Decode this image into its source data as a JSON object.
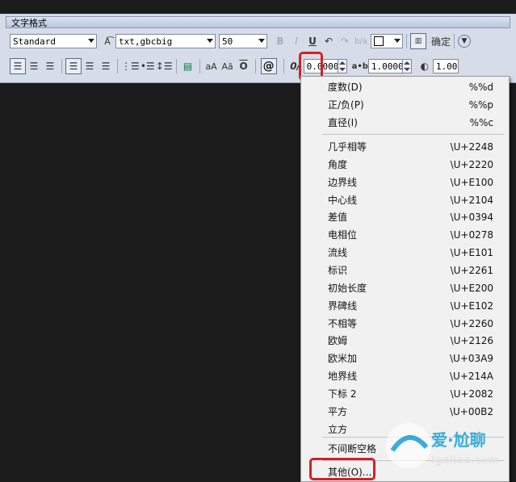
{
  "toolbar": {
    "title": "文字格式",
    "style_value": "Standard",
    "font_value": "txt,gbcbig",
    "height_value": "50",
    "confirm_label": "确定",
    "oblique_value": "0.0000",
    "tracking_label": "a•b",
    "tracking_value": "1.0000",
    "width_value": "1.0000",
    "icons": [
      "bold-icon",
      "italic-icon",
      "underline-icon",
      "undo-icon",
      "redo-icon",
      "stack-icon",
      "color-box-icon",
      "ruler-icon",
      "options-icon",
      "align-left-icon",
      "align-center-icon",
      "align-right-icon",
      "justify-icon",
      "center-icon",
      "distribute-icon",
      "numbering-icon",
      "bullets-icon",
      "line-spacing-icon",
      "insert-field-icon",
      "uppercase-icon",
      "lowercase-icon",
      "overline-icon",
      "symbol-at-icon",
      "oblique-icon",
      "tracking-icon",
      "width-factor-icon"
    ],
    "uppercase_label": "aA",
    "lowercase_label": "Aā",
    "overline_label": "O",
    "bold_label": "B",
    "italic_label": "I",
    "underline_label": "U",
    "symbol_label": "@",
    "oblique_label": "0/"
  },
  "menu": {
    "group1": [
      {
        "label": "度数(D)",
        "code": "%%d"
      },
      {
        "label": "正/负(P)",
        "code": "%%p"
      },
      {
        "label": "直径(I)",
        "code": "%%c"
      }
    ],
    "group2": [
      {
        "label": "几乎相等",
        "code": "\\U+2248"
      },
      {
        "label": "角度",
        "code": "\\U+2220"
      },
      {
        "label": "边界线",
        "code": "\\U+E100"
      },
      {
        "label": "中心线",
        "code": "\\U+2104"
      },
      {
        "label": "差值",
        "code": "\\U+0394"
      },
      {
        "label": "电相位",
        "code": "\\U+0278"
      },
      {
        "label": "流线",
        "code": "\\U+E101"
      },
      {
        "label": "标识",
        "code": "\\U+2261"
      },
      {
        "label": "初始长度",
        "code": "\\U+E200"
      },
      {
        "label": "界碑线",
        "code": "\\U+E102"
      },
      {
        "label": "不相等",
        "code": "\\U+2260"
      },
      {
        "label": "欧姆",
        "code": "\\U+2126"
      },
      {
        "label": "欧米加",
        "code": "\\U+03A9"
      },
      {
        "label": "地界线",
        "code": "\\U+214A"
      },
      {
        "label": "下标 2",
        "code": "\\U+2082"
      },
      {
        "label": "平方",
        "code": "\\U+00B2"
      },
      {
        "label": "立方",
        "code": ""
      }
    ],
    "nbsp_label": "不间断空格",
    "other_label": "其他(O)..."
  },
  "watermark": {
    "brand": "爱·尬聊",
    "site": "igaliao.com"
  },
  "colors": {
    "highlight": "#d32026",
    "menu_bg": "#f1f1f1",
    "toolbar_bg": "#d7dde8"
  }
}
